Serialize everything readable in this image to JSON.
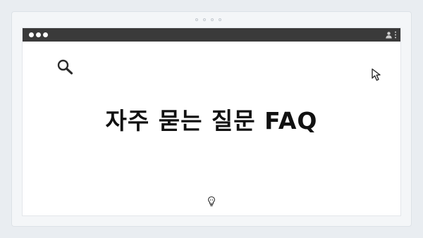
{
  "window": {
    "title": "자주 묻는 질문 FAQ"
  },
  "icons": {
    "outer_dots": [
      "dot-icon",
      "dot-icon",
      "dot-icon",
      "dot-icon"
    ],
    "traffic_lights": [
      "dot-icon",
      "dot-icon",
      "dot-icon"
    ],
    "top_right": [
      "user-icon",
      "kebab-menu-icon"
    ],
    "decorations": [
      "search-icon",
      "cursor-arrow-icon",
      "lightbulb-icon"
    ]
  },
  "colors": {
    "titlebar": "#3a3a3a",
    "background": "#e9edf1",
    "panel": "#ffffff",
    "text": "#111111"
  }
}
